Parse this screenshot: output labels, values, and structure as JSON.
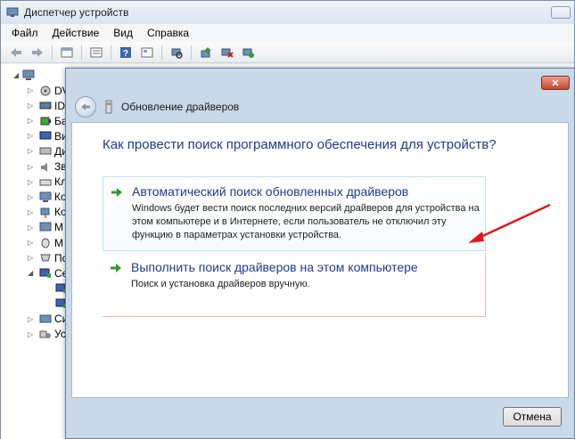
{
  "window": {
    "title": "Диспетчер устройств"
  },
  "menu": {
    "items": [
      "Файл",
      "Действие",
      "Вид",
      "Справка"
    ]
  },
  "toolbar": {
    "buttons": [
      "back-icon",
      "forward-icon",
      "properties-icon",
      "list-icon",
      "help-icon",
      "device-view-icon",
      "scan-hardware-icon",
      "update-driver-icon",
      "disable-icon",
      "uninstall-icon"
    ]
  },
  "tree": {
    "root_label": "",
    "items": [
      {
        "label": "DV",
        "icon": "dvd-drive-icon",
        "expander": "▷"
      },
      {
        "label": "ID",
        "icon": "ide-controller-icon",
        "expander": "▷"
      },
      {
        "label": "Ба",
        "icon": "battery-icon",
        "expander": "▷"
      },
      {
        "label": "Ви",
        "icon": "video-adapter-icon",
        "expander": "▷"
      },
      {
        "label": "Ди",
        "icon": "disk-drive-icon",
        "expander": "▷"
      },
      {
        "label": "Зв",
        "icon": "sound-icon",
        "expander": "▷"
      },
      {
        "label": "Кл",
        "icon": "keyboard-icon",
        "expander": "▷"
      },
      {
        "label": "Ко",
        "icon": "computer-icon",
        "expander": "▷"
      },
      {
        "label": "Ко",
        "icon": "usb-controller-icon",
        "expander": "▷"
      },
      {
        "label": "М",
        "icon": "monitor-icon",
        "expander": "▷"
      },
      {
        "label": "М",
        "icon": "mouse-icon",
        "expander": "▷"
      },
      {
        "label": "По",
        "icon": "port-icon",
        "expander": "▷"
      },
      {
        "label": "Се",
        "icon": "network-adapter-icon",
        "expander": "◢"
      },
      {
        "label": "",
        "icon": "network-adapter-icon",
        "expander": ""
      },
      {
        "label": "",
        "icon": "network-adapter-icon",
        "expander": ""
      },
      {
        "label": "Си",
        "icon": "system-device-icon",
        "expander": "▷"
      },
      {
        "label": "Ус",
        "icon": "hid-device-icon",
        "expander": "▷"
      }
    ]
  },
  "dialog": {
    "title": "Обновление драйверов",
    "close_label": "✕",
    "question": "Как провести поиск программного обеспечения для устройств?",
    "options": [
      {
        "title": "Автоматический поиск обновленных драйверов",
        "description": "Windows будет вести поиск последних версий драйверов для устройства на этом компьютере и в Интернете, если пользователь не отключил эту функцию в параметрах установки устройства."
      },
      {
        "title": "Выполнить поиск драйверов на этом компьютере",
        "description": "Поиск и установка драйверов вручную."
      }
    ],
    "cancel_label": "Отмена"
  },
  "colors": {
    "accent_text": "#1f3c8c",
    "option_arrow": "#2e9b2e",
    "annotation_arrow": "#e0191b"
  }
}
